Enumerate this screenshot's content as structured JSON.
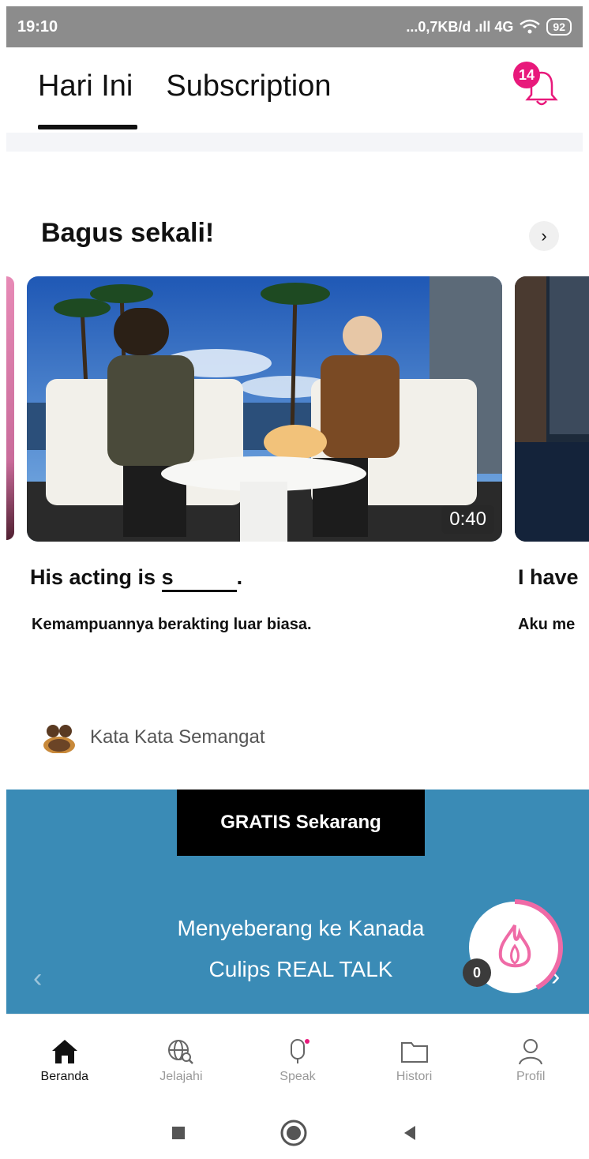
{
  "status_bar": {
    "time": "19:10",
    "network": "...0,7KB/d .ıll 4G",
    "battery": "92"
  },
  "tabs": [
    {
      "label": "Hari Ini",
      "active": true
    },
    {
      "label": "Subscription",
      "active": false
    }
  ],
  "notifications": {
    "badge_count": "14",
    "accent": "#e8197b"
  },
  "section": {
    "title": "Bagus sekali!",
    "arrow": "›"
  },
  "cards": [
    {
      "duration": "0:40",
      "sentence_prefix": "His acting is ",
      "blank_letter": "s",
      "sentence_suffix": ".",
      "translation": "Kemampuannya berakting luar biasa."
    },
    {
      "sentence": "I have",
      "translation": "Aku me"
    }
  ],
  "category": {
    "label": "Kata Kata Semangat"
  },
  "promo": {
    "button": "GRATIS Sekarang",
    "title": "Menyeberang ke Kanada",
    "subtitle": "Culips REAL TALK",
    "prev": "‹",
    "next": "›",
    "background": "#3a8bb6"
  },
  "fire": {
    "count": "0"
  },
  "nav": [
    {
      "label": "Beranda",
      "icon": "home-icon",
      "active": true
    },
    {
      "label": "Jelajahi",
      "icon": "globe-search-icon",
      "active": false
    },
    {
      "label": "Speak",
      "icon": "microphone-icon",
      "active": false
    },
    {
      "label": "Histori",
      "icon": "folder-icon",
      "active": false
    },
    {
      "label": "Profil",
      "icon": "person-icon",
      "active": false
    }
  ]
}
